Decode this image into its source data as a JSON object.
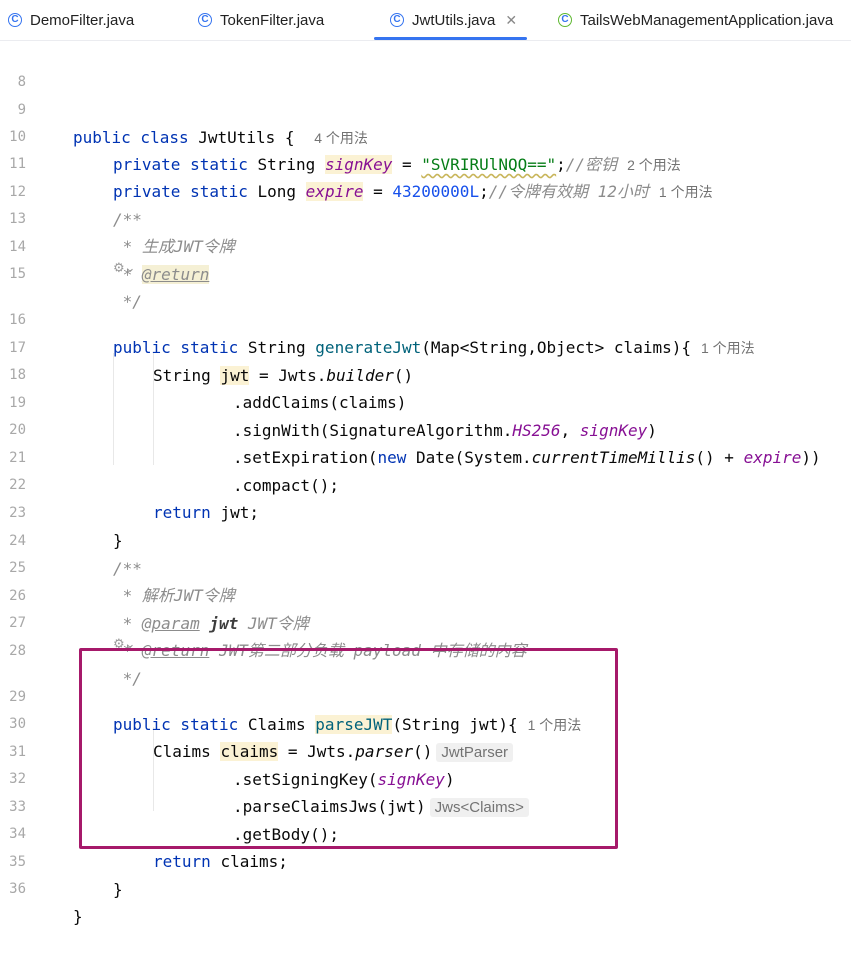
{
  "tabs": [
    {
      "label": "DemoFilter.java",
      "active": false
    },
    {
      "label": "TokenFilter.java",
      "active": false
    },
    {
      "label": "JwtUtils.java",
      "active": true
    },
    {
      "label": "TailsWebManagementApplication.java",
      "active": false
    }
  ],
  "tab_close": "✕",
  "usages": {
    "four": "4 个用法",
    "two": "2 个用法",
    "one": "1 个用法"
  },
  "hints": {
    "jwtparser": "JwtParser",
    "jws_claims": "Jws<Claims>"
  },
  "line_numbers": [
    "8",
    "9",
    "10",
    "11",
    "12",
    "13",
    "14",
    "15",
    "16",
    "17",
    "18",
    "19",
    "20",
    "21",
    "22",
    "23",
    "24",
    "25",
    "26",
    "27",
    "28",
    "29",
    "30",
    "31",
    "32",
    "33",
    "34",
    "35",
    "36"
  ],
  "code": {
    "l9": {
      "kw": "public class ",
      "name": "JwtUtils { "
    },
    "l10": {
      "kw": "private static ",
      "type": "String ",
      "field": "signKey",
      "eq": " = ",
      "str": "\"SVRIRUlNQQ==\"",
      "semi": ";",
      "cmt": "//密钥"
    },
    "l11": {
      "kw": "private static ",
      "type": "Long ",
      "field": "expire",
      "eq": " = ",
      "num": "43200000L",
      "semi": ";",
      "cmt": "//令牌有效期 12小时"
    },
    "l12": "/**",
    "l13": " * 生成JWT令牌",
    "l14_pre": " * ",
    "l14_tag": "@return",
    "l15": " */",
    "l16": {
      "kw": "public static ",
      "type": "String ",
      "method": "generateJwt",
      "args": "(Map<String,Object> claims){"
    },
    "l17": {
      "type": "String ",
      "var": "jwt",
      "rest1": " = Jwts.",
      "mcall": "builder",
      "rest2": "()"
    },
    "l18": ".addClaims(claims)",
    "l19": {
      "pre": ".signWith(SignatureAlgorithm.",
      "const": "HS256",
      "mid": ", ",
      "field": "signKey",
      "post": ")"
    },
    "l20": {
      "pre": ".setExpiration(",
      "kw": "new ",
      "mid": "Date(System.",
      "smeth": "currentTimeMillis",
      "mid2": "() + ",
      "field": "expire",
      "post": "))"
    },
    "l21": ".compact();",
    "l22": {
      "kw": "return ",
      "rest": "jwt;"
    },
    "l23": "}",
    "l24": "/**",
    "l25": " * 解析JWT令牌",
    "l26": {
      "pre": " * ",
      "tag": "@param",
      "mid": " ",
      "bold": "jwt",
      "post": " JWT令牌"
    },
    "l27": {
      "pre": " * ",
      "tag": "@return",
      "post": " JWT第二部分负载 payload 中存储的内容"
    },
    "l28": " */",
    "l29": {
      "kw": "public static ",
      "type": "Claims ",
      "method": "parseJWT",
      "args": "(String jwt){"
    },
    "l30": {
      "type": "Claims ",
      "var": "claims",
      "rest1": " = Jwts.",
      "mcall": "parser",
      "rest2": "()"
    },
    "l31": {
      "pre": ".setSigningKey(",
      "field": "signKey",
      "post": ")"
    },
    "l32": ".parseClaimsJws(jwt)",
    "l33": ".getBody();",
    "l34": {
      "kw": "return ",
      "rest": "claims;"
    },
    "l35": "}",
    "l36": "}"
  },
  "colors": {
    "keyword": "#0033b3",
    "string": "#067d17",
    "number": "#1750eb",
    "field": "#871094",
    "method": "#00627a",
    "comment": "#8c8c8c",
    "highlight_box": "#a6196a",
    "tab_accent": "#3574f0"
  }
}
